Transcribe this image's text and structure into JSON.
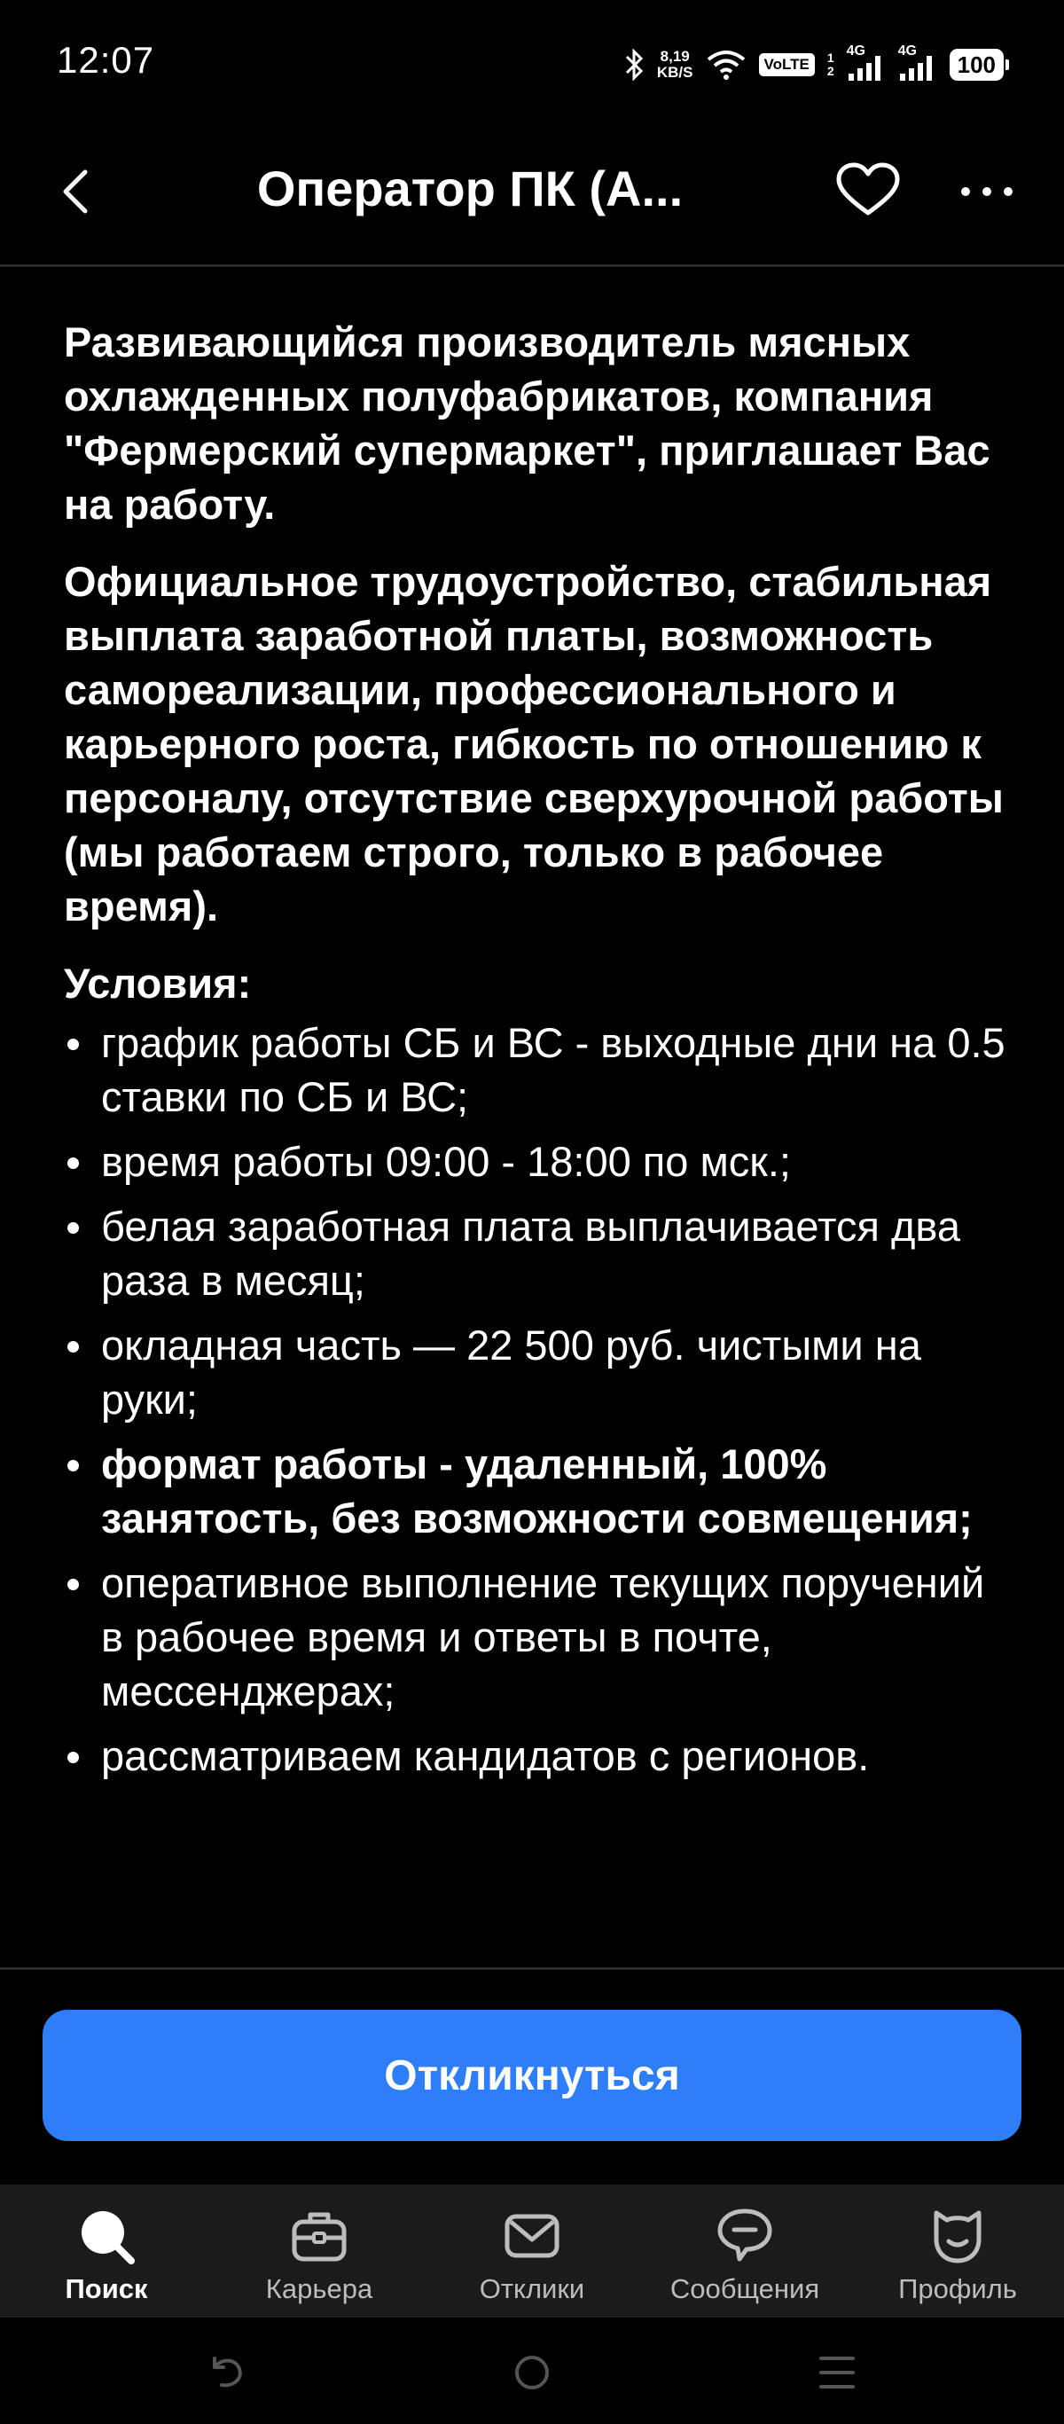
{
  "status_bar": {
    "time": "12:07",
    "net_speed_value": "8,19",
    "net_speed_unit": "KB/S",
    "volte": "VoLTE",
    "sim1": "1",
    "sim2": "2",
    "network1": "4G",
    "network2": "4G",
    "battery": "100"
  },
  "header": {
    "title": "Оператор ПК (А..."
  },
  "content": {
    "intro": "Развивающийся производитель мясных охлажденных полуфабрикатов, компания \"Фермерский супермаркет\", приглашает Вас на работу.",
    "benefits": "Официальное трудоустройство, стабильная выплата заработной платы, возможность самореализации, профессионального и карьерного роста, гибкость по отношению к персоналу, отсутствие сверхурочной работы (мы работаем строго, только в рабочее время).",
    "conditions_title": "Условия:",
    "conditions": [
      {
        "text": "график работы СБ и ВС - выходные дни на 0.5 ставки по СБ и ВС;",
        "bold": false
      },
      {
        "text": "время работы 09:00 - 18:00 по мск.;",
        "bold": false
      },
      {
        "text": "белая заработная плата выплачивается два раза в месяц;",
        "bold": false
      },
      {
        "text": "окладная часть — 22 500 руб. чистыми на руки;",
        "bold": false
      },
      {
        "text": "формат работы - удаленный, 100% занятость, без возможности совмещения;",
        "bold": true
      },
      {
        "text": "оперативное выполнение текущих поручений в рабочее время и ответы в почте, мессенджерах;",
        "bold": false
      },
      {
        "text": "рассматриваем кандидатов с регионов.",
        "bold": false
      }
    ]
  },
  "apply_button": "Откликнуться",
  "bottom_nav": [
    {
      "label": "Поиск",
      "icon": "search-icon",
      "active": true
    },
    {
      "label": "Карьера",
      "icon": "briefcase-icon",
      "active": false
    },
    {
      "label": "Отклики",
      "icon": "mail-icon",
      "active": false
    },
    {
      "label": "Сообщения",
      "icon": "chat-icon",
      "active": false
    },
    {
      "label": "Профиль",
      "icon": "profile-icon",
      "active": false
    }
  ],
  "colors": {
    "background": "#000000",
    "accent": "#2d7ef8",
    "nav_background": "#1b1b1b"
  }
}
